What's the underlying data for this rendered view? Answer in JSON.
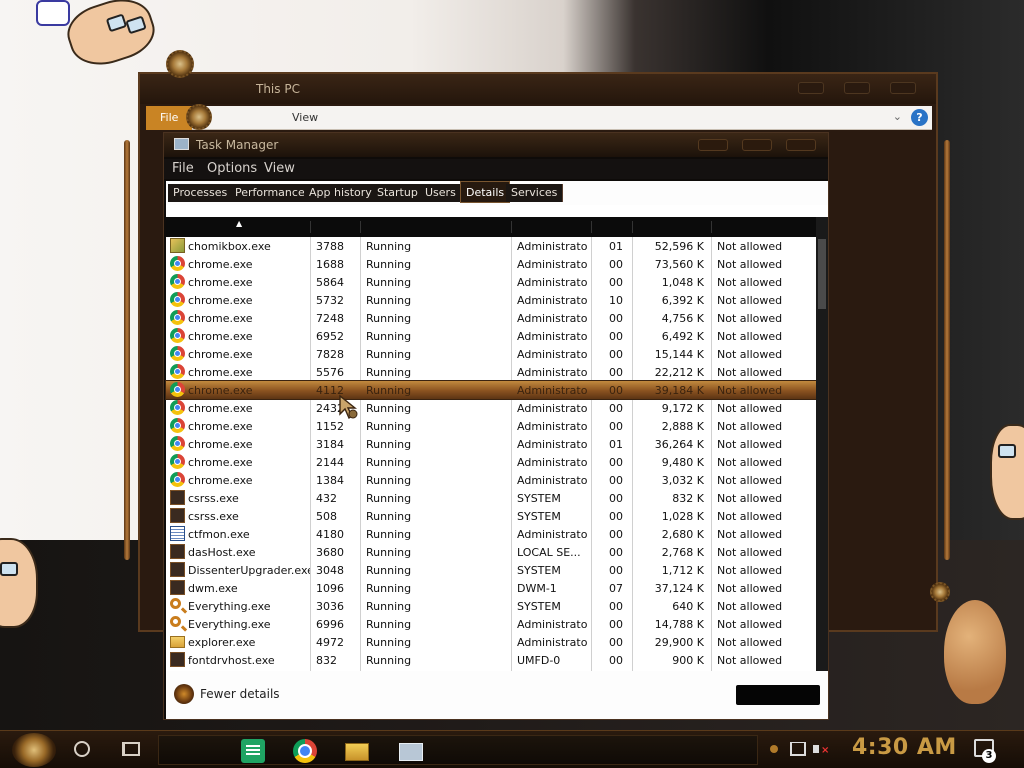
{
  "explorer": {
    "title": "This PC",
    "ribbon_file": "File",
    "ribbon_view": "View",
    "help": "?"
  },
  "taskmgr": {
    "title": "Task Manager",
    "menu": {
      "file": "File",
      "options": "Options",
      "view": "View"
    },
    "tabs": [
      "Processes",
      "Performance",
      "App history",
      "Startup",
      "Users",
      "Details",
      "Services"
    ],
    "active_tab": "Details",
    "rows": [
      {
        "icon": "chomikbox-icon",
        "name": "chomikbox.exe",
        "pid": "3788",
        "status": "Running",
        "user": "Administrator",
        "cpu": "01",
        "mem": "52,596 K",
        "uac": "Not allowed"
      },
      {
        "icon": "chrome-icon",
        "name": "chrome.exe",
        "pid": "1688",
        "status": "Running",
        "user": "Administrator",
        "cpu": "00",
        "mem": "73,560 K",
        "uac": "Not allowed"
      },
      {
        "icon": "chrome-icon",
        "name": "chrome.exe",
        "pid": "5864",
        "status": "Running",
        "user": "Administrator",
        "cpu": "00",
        "mem": "1,048 K",
        "uac": "Not allowed"
      },
      {
        "icon": "chrome-icon",
        "name": "chrome.exe",
        "pid": "5732",
        "status": "Running",
        "user": "Administrator",
        "cpu": "10",
        "mem": "6,392 K",
        "uac": "Not allowed"
      },
      {
        "icon": "chrome-icon",
        "name": "chrome.exe",
        "pid": "7248",
        "status": "Running",
        "user": "Administrator",
        "cpu": "00",
        "mem": "4,756 K",
        "uac": "Not allowed"
      },
      {
        "icon": "chrome-icon",
        "name": "chrome.exe",
        "pid": "6952",
        "status": "Running",
        "user": "Administrator",
        "cpu": "00",
        "mem": "6,492 K",
        "uac": "Not allowed"
      },
      {
        "icon": "chrome-icon",
        "name": "chrome.exe",
        "pid": "7828",
        "status": "Running",
        "user": "Administrator",
        "cpu": "00",
        "mem": "15,144 K",
        "uac": "Not allowed"
      },
      {
        "icon": "chrome-icon",
        "name": "chrome.exe",
        "pid": "5576",
        "status": "Running",
        "user": "Administrator",
        "cpu": "00",
        "mem": "22,212 K",
        "uac": "Not allowed"
      },
      {
        "icon": "chrome-icon",
        "name": "chrome.exe",
        "pid": "4112",
        "status": "Running",
        "user": "Administrator",
        "cpu": "00",
        "mem": "39,184 K",
        "uac": "Not allowed",
        "selected": true
      },
      {
        "icon": "chrome-icon",
        "name": "chrome.exe",
        "pid": "2432",
        "status": "Running",
        "user": "Administrator",
        "cpu": "00",
        "mem": "9,172 K",
        "uac": "Not allowed"
      },
      {
        "icon": "chrome-icon",
        "name": "chrome.exe",
        "pid": "1152",
        "status": "Running",
        "user": "Administrator",
        "cpu": "00",
        "mem": "2,888 K",
        "uac": "Not allowed"
      },
      {
        "icon": "chrome-icon",
        "name": "chrome.exe",
        "pid": "3184",
        "status": "Running",
        "user": "Administrator",
        "cpu": "01",
        "mem": "36,264 K",
        "uac": "Not allowed"
      },
      {
        "icon": "chrome-icon",
        "name": "chrome.exe",
        "pid": "2144",
        "status": "Running",
        "user": "Administrator",
        "cpu": "00",
        "mem": "9,480 K",
        "uac": "Not allowed"
      },
      {
        "icon": "chrome-icon",
        "name": "chrome.exe",
        "pid": "1384",
        "status": "Running",
        "user": "Administrator",
        "cpu": "00",
        "mem": "3,032 K",
        "uac": "Not allowed"
      },
      {
        "icon": "system-process-icon",
        "name": "csrss.exe",
        "pid": "432",
        "status": "Running",
        "user": "SYSTEM",
        "cpu": "00",
        "mem": "832 K",
        "uac": "Not allowed"
      },
      {
        "icon": "system-process-icon",
        "name": "csrss.exe",
        "pid": "508",
        "status": "Running",
        "user": "SYSTEM",
        "cpu": "00",
        "mem": "1,028 K",
        "uac": "Not allowed"
      },
      {
        "icon": "notepad-icon",
        "name": "ctfmon.exe",
        "pid": "4180",
        "status": "Running",
        "user": "Administrator",
        "cpu": "00",
        "mem": "2,680 K",
        "uac": "Not allowed"
      },
      {
        "icon": "system-process-icon",
        "name": "dasHost.exe",
        "pid": "3680",
        "status": "Running",
        "user": "LOCAL SE...",
        "cpu": "00",
        "mem": "2,768 K",
        "uac": "Not allowed"
      },
      {
        "icon": "system-process-icon",
        "name": "DissenterUpgrader.exe",
        "pid": "3048",
        "status": "Running",
        "user": "SYSTEM",
        "cpu": "00",
        "mem": "1,712 K",
        "uac": "Not allowed"
      },
      {
        "icon": "system-process-icon",
        "name": "dwm.exe",
        "pid": "1096",
        "status": "Running",
        "user": "DWM-1",
        "cpu": "07",
        "mem": "37,124 K",
        "uac": "Not allowed"
      },
      {
        "icon": "everything-search-icon",
        "name": "Everything.exe",
        "pid": "3036",
        "status": "Running",
        "user": "SYSTEM",
        "cpu": "00",
        "mem": "640 K",
        "uac": "Not allowed"
      },
      {
        "icon": "everything-search-icon",
        "name": "Everything.exe",
        "pid": "6996",
        "status": "Running",
        "user": "Administrator",
        "cpu": "00",
        "mem": "14,788 K",
        "uac": "Not allowed"
      },
      {
        "icon": "folder-icon",
        "name": "explorer.exe",
        "pid": "4972",
        "status": "Running",
        "user": "Administrator",
        "cpu": "00",
        "mem": "29,900 K",
        "uac": "Not allowed"
      },
      {
        "icon": "system-process-icon",
        "name": "fontdrvhost.exe",
        "pid": "832",
        "status": "Running",
        "user": "UMFD-0",
        "cpu": "00",
        "mem": "900 K",
        "uac": "Not allowed"
      }
    ],
    "footer": {
      "fewer_details": "Fewer details"
    }
  },
  "taskbar": {
    "clock": "4:30 AM",
    "notification_count": "3"
  }
}
